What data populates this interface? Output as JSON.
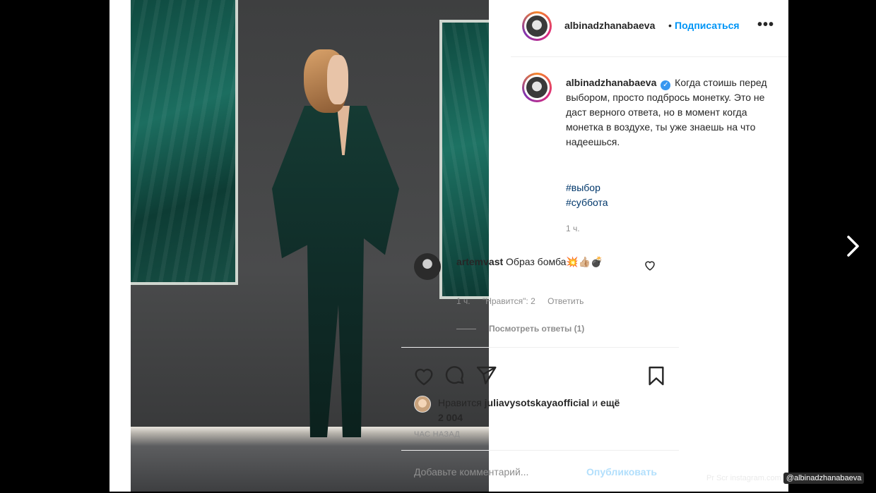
{
  "post": {
    "author": "albinadzhanabaeva",
    "separator": "•",
    "follow_label": "Подписаться",
    "more_icon": "•••",
    "caption": "Когда стоишь перед выбором, просто подбрось монетку. Это не даст верного ответа, но в момент когда монетка в воздухе, ты уже знаешь на что надеешься.",
    "hashtags": [
      "#выбор",
      "#суббота"
    ],
    "caption_time": "1 ч."
  },
  "comment": {
    "author": "artemvast",
    "text": "Образ бомба💥👍🏼💣",
    "time": "1 ч.",
    "likes": "\"Нравится\": 2",
    "reply_label": "Ответить",
    "view_replies": "Посмотреть ответы (1)"
  },
  "likes": {
    "prefix": "Нравится",
    "user": "juliavysotskayaofficial",
    "suffix": "и",
    "others": "ещё 2 004"
  },
  "posted_ago": "ЧАС НАЗАД",
  "add_comment": {
    "placeholder": "Добавьте комментарий...",
    "publish_label": "Опубликовать"
  },
  "watermark": {
    "source": "Pr Scr instagram.com",
    "handle": "@albinadzhanabaeva"
  },
  "colors": {
    "accent": "#0095f6",
    "link": "#00376b",
    "muted": "#8e8e8e"
  }
}
